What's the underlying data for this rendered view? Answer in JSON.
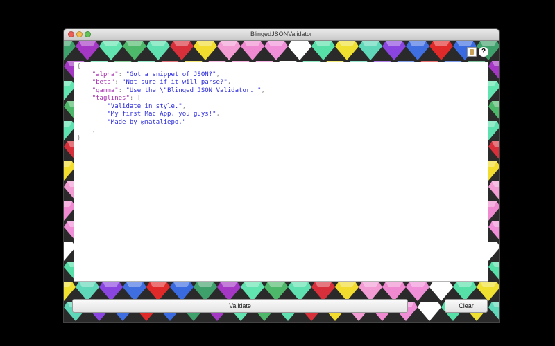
{
  "window": {
    "title": "BlingedJSONValidator"
  },
  "editor": {
    "lines": [
      [
        {
          "t": "{",
          "c": "p"
        }
      ],
      [
        {
          "t": "    ",
          "c": "p"
        },
        {
          "t": "\"alpha\"",
          "c": "k"
        },
        {
          "t": ": ",
          "c": "p"
        },
        {
          "t": "\"Got a snippet of JSON?\"",
          "c": "s"
        },
        {
          "t": ",",
          "c": "p"
        }
      ],
      [
        {
          "t": "    ",
          "c": "p"
        },
        {
          "t": "\"beta\"",
          "c": "k"
        },
        {
          "t": ": ",
          "c": "p"
        },
        {
          "t": "\"Not sure if it will parse?\"",
          "c": "s"
        },
        {
          "t": ",",
          "c": "p"
        }
      ],
      [
        {
          "t": "    ",
          "c": "p"
        },
        {
          "t": "\"gamma\"",
          "c": "k"
        },
        {
          "t": ": ",
          "c": "p"
        },
        {
          "t": "\"Use the \\\"Blinged JSON Validator. \"",
          "c": "s"
        },
        {
          "t": ",",
          "c": "p"
        }
      ],
      [
        {
          "t": "    ",
          "c": "p"
        },
        {
          "t": "\"taglines\"",
          "c": "k"
        },
        {
          "t": ": [",
          "c": "p"
        }
      ],
      [
        {
          "t": "        ",
          "c": "p"
        },
        {
          "t": "\"Validate in style.\"",
          "c": "s"
        },
        {
          "t": ",",
          "c": "p"
        }
      ],
      [
        {
          "t": "        ",
          "c": "p"
        },
        {
          "t": "\"My first Mac App, you guys!\"",
          "c": "s"
        },
        {
          "t": ",",
          "c": "p"
        }
      ],
      [
        {
          "t": "        ",
          "c": "p"
        },
        {
          "t": "\"Made by @nataliepo.\"",
          "c": "s"
        }
      ],
      [
        {
          "t": "    ]",
          "c": "p"
        }
      ],
      [
        {
          "t": "}",
          "c": "p"
        }
      ]
    ]
  },
  "buttons": {
    "validate": "Validate",
    "clear": "Clear"
  },
  "icons": {
    "book": "book-icon",
    "help": "help-icon"
  },
  "help_glyph": "?",
  "colors": {
    "key": "#a62bb0",
    "string": "#2a2adc",
    "gems": [
      "#3ea06a",
      "#56e0a8",
      "#5ee0b0",
      "#3f6ee0",
      "#f08ad0",
      "#a437c4",
      "#f0e030",
      "#d8303a",
      "#e02a2a",
      "#f08fd8",
      "#62e4b0",
      "#5ed8b8",
      "#f2dc2e",
      "#3a6ae0",
      "#ffffff",
      "#4eb86a",
      "#8a44e0",
      "#f39cd4"
    ]
  }
}
